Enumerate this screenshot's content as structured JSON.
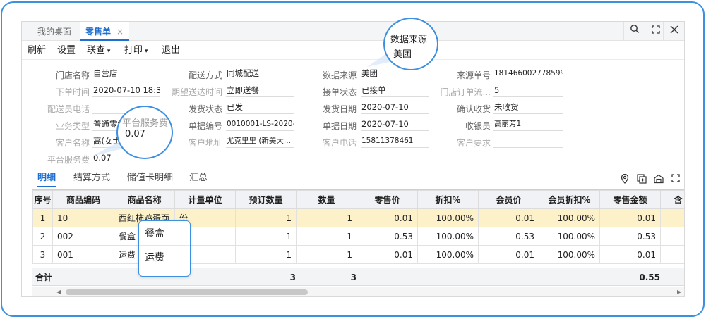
{
  "tabs": [
    {
      "label": "我的桌面"
    },
    {
      "label": "零售单",
      "close": "×"
    }
  ],
  "toolbar": {
    "refresh": "刷新",
    "settings": "设置",
    "linked_query": "联查",
    "print": "打印",
    "exit": "退出"
  },
  "form": {
    "store_name": {
      "label": "门店名称",
      "value": "自营店"
    },
    "order_time": {
      "label": "下单时间",
      "value": "2020-07-10 18:3..."
    },
    "delivery_person_phone": {
      "label": "配送员电话",
      "value": ""
    },
    "business_type": {
      "label": "业务类型",
      "value": "普通零售"
    },
    "customer_name": {
      "label": "客户名称",
      "value": "高(女士)"
    },
    "platform_fee": {
      "label": "平台服务费",
      "value": "0.07"
    },
    "delivery_method": {
      "label": "配送方式",
      "value": "同城配送"
    },
    "expected_delivery": {
      "label": "期望送达时间",
      "value": "立即送餐"
    },
    "shipping_status": {
      "label": "发货状态",
      "value": "已发"
    },
    "document_number": {
      "label": "单据编号",
      "value": "0010001-LS-2020-..."
    },
    "customer_address": {
      "label": "客户地址",
      "value": "尤克里里 (新美大..."
    },
    "data_source": {
      "label": "数据来源",
      "value": "美团"
    },
    "order_accept_status": {
      "label": "接单状态",
      "value": "已接单"
    },
    "shipping_date": {
      "label": "发货日期",
      "value": "2020-07-10"
    },
    "document_date": {
      "label": "单据日期",
      "value": "2020-07-10"
    },
    "customer_phone": {
      "label": "客户电话",
      "value": "15811378461"
    },
    "source_number": {
      "label": "来源单号",
      "value": "181466002778599..."
    },
    "store_order_number": {
      "label": "门店订单流...",
      "value": "5"
    },
    "confirm_receipt": {
      "label": "确认收货",
      "value": "未收货"
    },
    "cashier": {
      "label": "收银员",
      "value": "高丽芳1"
    },
    "customer_request": {
      "label": "客户要求",
      "value": ""
    }
  },
  "detail_tabs": [
    "明细",
    "结算方式",
    "储值卡明细",
    "汇总"
  ],
  "right_icons": [
    "location-pin-icon",
    "add-copy-icon",
    "store-icon",
    "fullscreen-icon"
  ],
  "table": {
    "headers": [
      "序号",
      "商品编码",
      "商品名称",
      "计量单位",
      "预订数量",
      "数量",
      "零售价",
      "折扣%",
      "会员价",
      "会员折扣%",
      "零售金额",
      "含"
    ],
    "rows": [
      [
        "1",
        "10",
        "西红柿鸡蛋面",
        "份",
        "1",
        "1",
        "0.01",
        "100.00%",
        "0.01",
        "100.00%",
        "0.01",
        ""
      ],
      [
        "2",
        "002",
        "餐盒",
        "",
        "1",
        "1",
        "0.53",
        "100.00%",
        "0.53",
        "100.00%",
        "0.53",
        ""
      ],
      [
        "3",
        "001",
        "运费",
        "",
        "1",
        "1",
        "0.01",
        "100.00%",
        "0.01",
        "100.00%",
        "0.01",
        ""
      ]
    ],
    "summary": {
      "label": "合计",
      "preorder_qty": "3",
      "qty": "3",
      "retail_amount": "0.55"
    }
  },
  "callouts": {
    "data_source": {
      "line1": "数据来源",
      "line2": "美团"
    },
    "platform_fee": {
      "line1": "平台服务费",
      "line2": "0.07"
    },
    "product_popup": [
      "餐盒",
      "运费"
    ]
  },
  "colors": {
    "accent": "#1f6fd1",
    "callout_border": "#3d8fe0",
    "selected_row": "#fcf1c9"
  }
}
